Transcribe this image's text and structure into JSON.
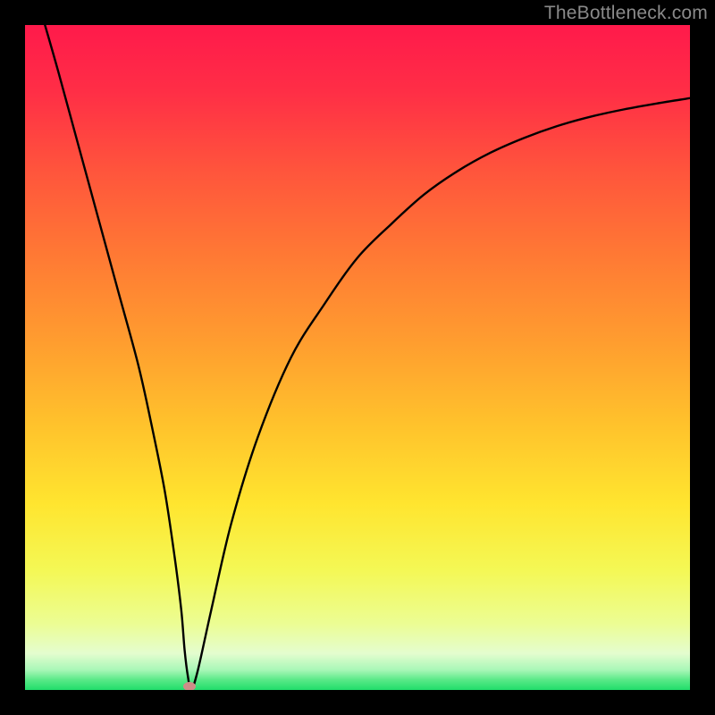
{
  "watermark": "TheBottleneck.com",
  "chart_data": {
    "type": "line",
    "title": "",
    "xlabel": "",
    "ylabel": "",
    "xlim": [
      0,
      100
    ],
    "ylim": [
      0,
      100
    ],
    "series": [
      {
        "name": "bottleneck-curve",
        "x": [
          3,
          5,
          8,
          11,
          14,
          17,
          19,
          21,
          22.5,
          23.5,
          24,
          24.5,
          25,
          26,
          28,
          31,
          35,
          40,
          45,
          50,
          55,
          60,
          65,
          70,
          75,
          80,
          85,
          90,
          95,
          100
        ],
        "y": [
          100,
          93,
          82,
          71,
          60,
          49,
          40,
          30,
          20,
          12,
          6,
          2,
          0,
          3,
          12,
          25,
          38,
          50,
          58,
          65,
          70,
          74.5,
          78,
          80.8,
          83,
          84.8,
          86.2,
          87.3,
          88.2,
          89
        ]
      }
    ],
    "marker": {
      "x": 24.7,
      "y": 0.6
    },
    "gradient_stops": [
      {
        "offset": 0.0,
        "color": "#ff1a4b"
      },
      {
        "offset": 0.1,
        "color": "#ff2e46"
      },
      {
        "offset": 0.22,
        "color": "#ff553c"
      },
      {
        "offset": 0.35,
        "color": "#ff7a34"
      },
      {
        "offset": 0.48,
        "color": "#ff9e2f"
      },
      {
        "offset": 0.6,
        "color": "#ffc22c"
      },
      {
        "offset": 0.72,
        "color": "#ffe52f"
      },
      {
        "offset": 0.82,
        "color": "#f4f855"
      },
      {
        "offset": 0.9,
        "color": "#ecfd93"
      },
      {
        "offset": 0.945,
        "color": "#e4fdcf"
      },
      {
        "offset": 0.97,
        "color": "#a8f7b7"
      },
      {
        "offset": 0.985,
        "color": "#58e987"
      },
      {
        "offset": 1.0,
        "color": "#21dd6a"
      }
    ]
  }
}
